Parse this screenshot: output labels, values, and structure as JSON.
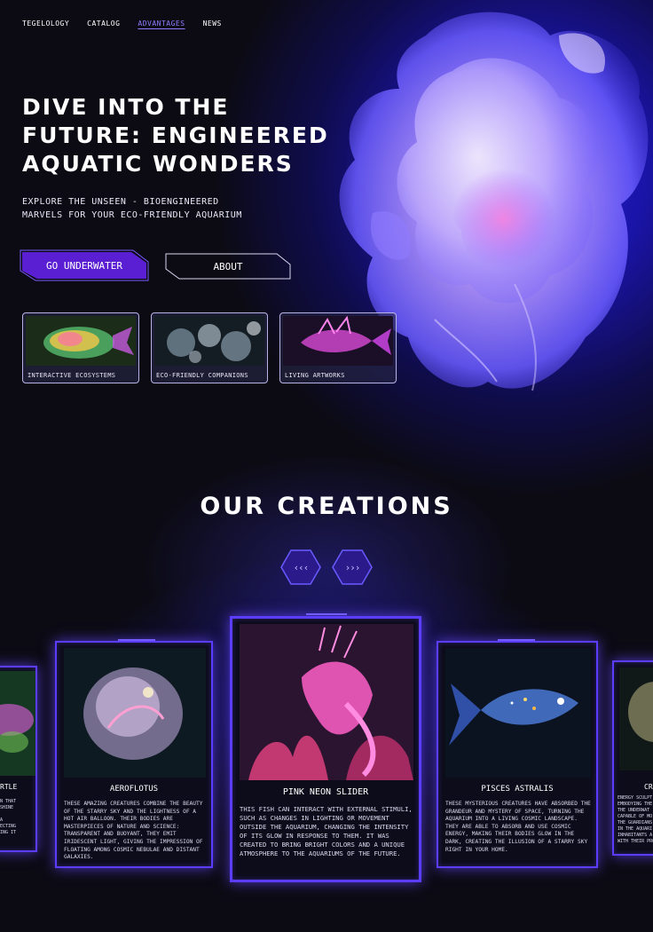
{
  "nav": {
    "items": [
      {
        "label": "TEGELOLOGY",
        "active": false
      },
      {
        "label": "CATALOG",
        "active": false
      },
      {
        "label": "ADVANTAGES",
        "active": true
      },
      {
        "label": "NEWS",
        "active": false
      }
    ]
  },
  "hero": {
    "title_line1": "DIVE INTO THE",
    "title_line2": "FUTURE: ENGINEERED",
    "title_line3": "AQUATIC WONDERS",
    "subtitle_line1": "EXPLORE THE UNSEEN - BIOENGINEERED",
    "subtitle_line2": "MARVELS FOR YOUR ECO-FRIENDLY AQUARIUM",
    "primary_button": "GO UNDERWATER",
    "secondary_button": "ABOUT",
    "thumbnails": [
      {
        "caption": "INTERACTIVE ECOSYSTEMS",
        "icon": "glowing-fish-image"
      },
      {
        "caption": "ECO-FRIENDLY COMPANIONS",
        "icon": "bubble-creatures-image"
      },
      {
        "caption": "LIVING ARTWORKS",
        "icon": "neon-fish-image"
      }
    ]
  },
  "creations": {
    "title": "OUR CREATIONS",
    "prev_label": "‹‹‹",
    "next_label": "›››",
    "cards": [
      {
        "name": "RTLE",
        "desc": "N THAT\nSHINE\n\nA\nECTING\nING IT"
      },
      {
        "name": "AEROFLOTUS",
        "desc": "THESE AMAZING CREATURES COMBINE THE BEAUTY OF THE STARRY SKY AND THE LIGHTNESS OF A HOT AIR BALLOON. THEIR BODIES ARE MASTERPIECES OF NATURE AND SCIENCE: TRANSPARENT AND BUOYANT, THEY EMIT IRIDESCENT LIGHT, GIVING THE IMPRESSION OF FLOATING AMONG COSMIC NEBULAE AND DISTANT GALAXIES."
      },
      {
        "name": "PINK NEON SLIDER",
        "desc": "THIS FISH CAN INTERACT WITH EXTERNAL STIMULI, SUCH AS CHANGES IN LIGHTING OR MOVEMENT OUTSIDE THE AQUARIUM, CHANGING THE INTENSITY OF ITS GLOW IN RESPONSE TO THEM. IT WAS CREATED TO BRING BRIGHT COLORS AND A UNIQUE ATMOSPHERE TO THE AQUARIUMS OF THE FUTURE."
      },
      {
        "name": "PISCES ASTRALIS",
        "desc": "THESE MYSTERIOUS CREATURES HAVE ABSORBED THE GRANDEUR AND MYSTERY OF SPACE, TURNING THE AQUARIUM INTO A LIVING COSMIC LANDSCAPE. THEY ARE ABLE TO ABSORB AND USE COSMIC ENERGY, MAKING THEIR BODIES GLOW IN THE DARK, CREATING THE ILLUSION OF A STARRY SKY RIGHT IN YOUR HOME."
      },
      {
        "name": "CR",
        "desc": "ENERGY SCULPT\nEMBODYING THE\nTHE UNDERWAT\nCAPABLE OF MO\nTHE GUARDIANS\nIN THE AQUARI\nINHABITANTS A\nWITH THEIR PRO"
      }
    ]
  },
  "colors": {
    "accent": "#5a1fd2",
    "glow": "#5b3dff",
    "background": "#0c0b14"
  }
}
